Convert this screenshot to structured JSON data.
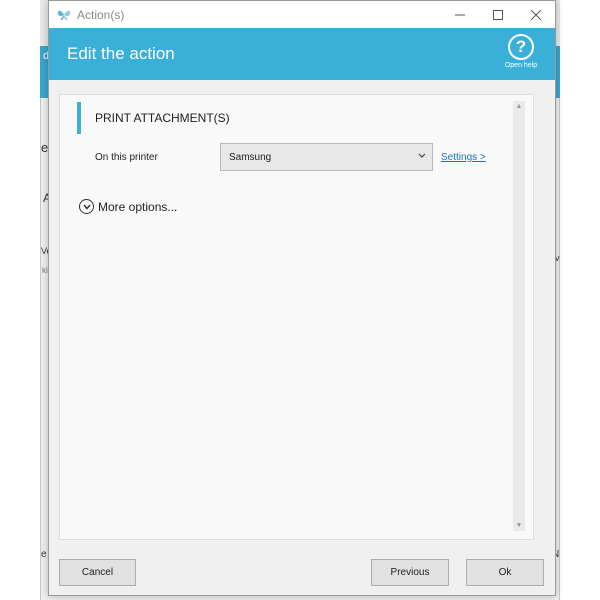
{
  "window": {
    "title": "Action(s)",
    "controls": {
      "minimize": "—",
      "maximize": "☐",
      "close": "✕"
    }
  },
  "header": {
    "title": "Edit the action",
    "help_label": "Open help",
    "help_glyph": "?"
  },
  "section": {
    "title": "PRINT ATTACHMENT(S)"
  },
  "printer": {
    "label": "On this printer",
    "selected": "Samsung",
    "settings_link": "Settings >"
  },
  "more_options": {
    "label": "More options..."
  },
  "footer": {
    "cancel": "Cancel",
    "previous": "Previous",
    "ok": "Ok"
  },
  "background_fragments": {
    "top_left": "d",
    "left_mid": "e",
    "left_a": "A",
    "left_ve": "Ve",
    "left_ki": "ki",
    "right_pv": "pv",
    "bottom_left": "e",
    "bottom_right": "N"
  },
  "colors": {
    "accent": "#3aafd8",
    "link": "#1a73c8"
  },
  "icons": {
    "app": "butterfly-icon",
    "help": "question-circle-icon",
    "expand": "chevron-down-circle-icon",
    "dropdown": "chevron-down-icon"
  }
}
